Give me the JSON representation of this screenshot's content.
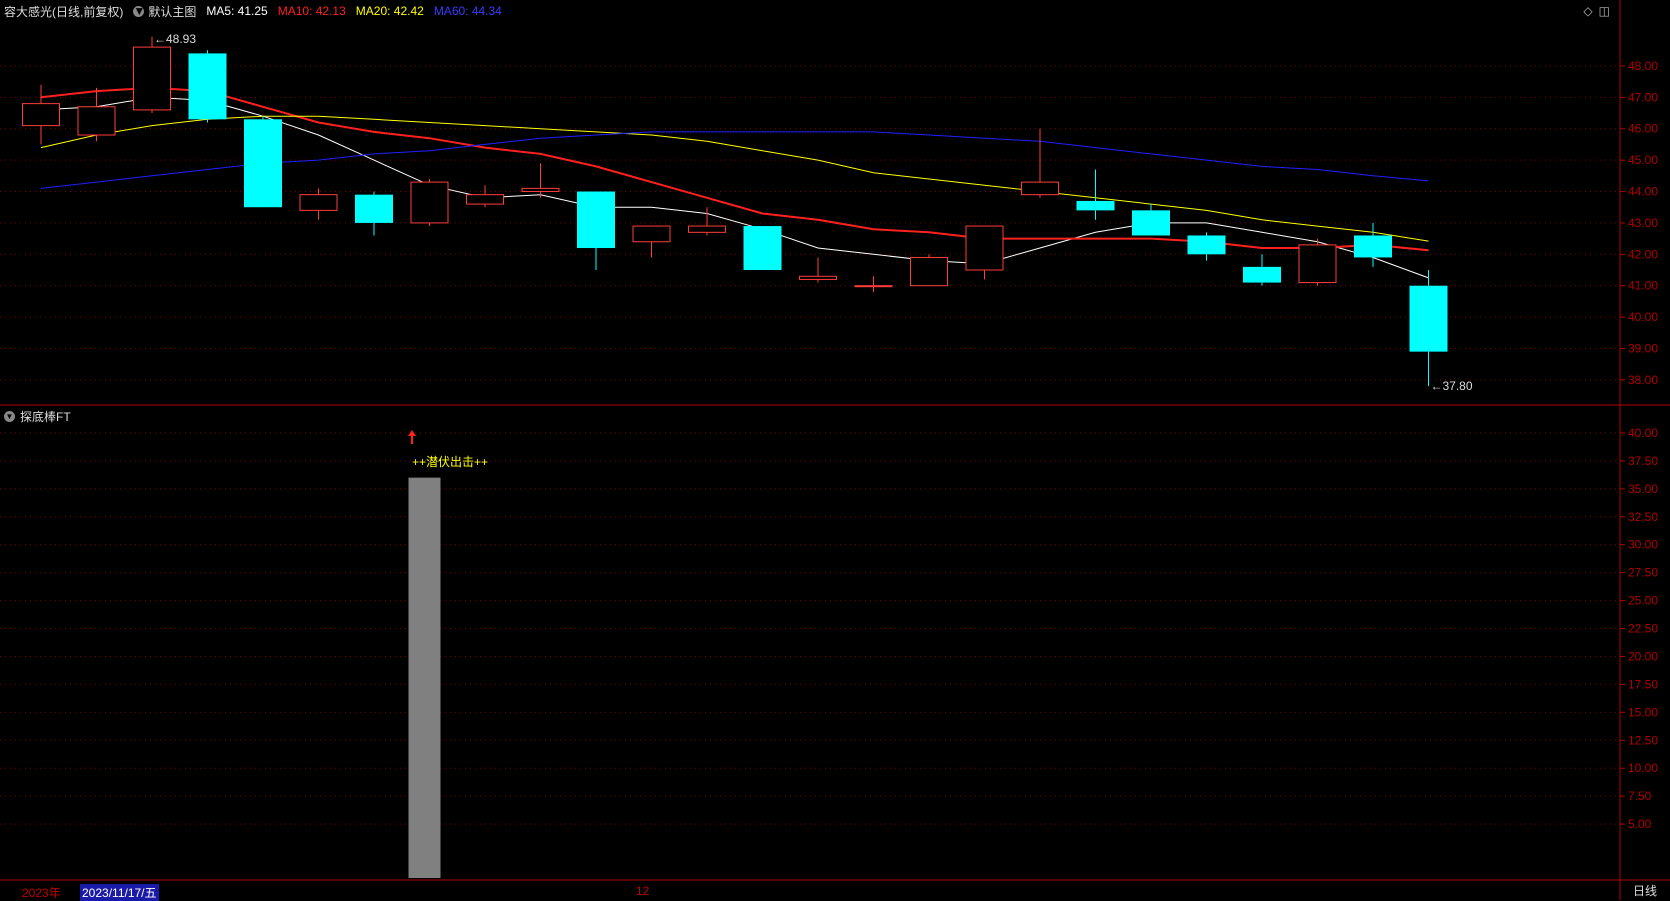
{
  "header": {
    "stock_title": "容大感光(日线,前复权)",
    "template_label": "默认主图",
    "ma5_label": "MA5: 41.25",
    "ma10_label": "MA10: 42.13",
    "ma20_label": "MA20: 42.42",
    "ma60_label": "MA60: 44.34"
  },
  "colors": {
    "up": "#ff3b3b",
    "down": "#00ffff",
    "ma5": "#ffffff",
    "ma10": "#ff2020",
    "ma20": "#ffff00",
    "ma60": "#2020ff",
    "axis": "#b00000",
    "bar": "#808080",
    "signal_text": "#ffff00"
  },
  "indicator": {
    "title": "探底棒FT",
    "signal_label": "++潜伏出击++"
  },
  "footer": {
    "year_label": "2023年",
    "date_label": "2023/11/17/五",
    "month_label": "12",
    "period_button": "日线"
  },
  "chart_data": [
    {
      "type": "candlestick",
      "ylim": [
        37.2,
        49.4
      ],
      "ytick_values": [
        38,
        39,
        40,
        41,
        42,
        43,
        44,
        45,
        46,
        47,
        48
      ],
      "ytick_labels": [
        "38.00",
        "39.00",
        "40.00",
        "41.00",
        "42.00",
        "43.00",
        "44.00",
        "45.00",
        "46.00",
        "47.00",
        "48.00"
      ],
      "candles": [
        {
          "o": 46.1,
          "h": 47.4,
          "l": 45.5,
          "c": 46.8
        },
        {
          "o": 45.8,
          "h": 47.3,
          "l": 45.6,
          "c": 46.7
        },
        {
          "o": 46.6,
          "h": 48.93,
          "l": 46.5,
          "c": 48.6
        },
        {
          "o": 48.4,
          "h": 48.5,
          "l": 46.2,
          "c": 46.3
        },
        {
          "o": 46.3,
          "h": 46.4,
          "l": 43.5,
          "c": 43.5
        },
        {
          "o": 43.4,
          "h": 44.1,
          "l": 43.1,
          "c": 43.9
        },
        {
          "o": 43.9,
          "h": 44.0,
          "l": 42.6,
          "c": 43.0
        },
        {
          "o": 43.0,
          "h": 44.4,
          "l": 42.9,
          "c": 44.3
        },
        {
          "o": 43.6,
          "h": 44.2,
          "l": 43.5,
          "c": 43.9
        },
        {
          "o": 44.0,
          "h": 44.9,
          "l": 43.8,
          "c": 44.1
        },
        {
          "o": 44.0,
          "h": 44.0,
          "l": 41.5,
          "c": 42.2
        },
        {
          "o": 42.4,
          "h": 42.9,
          "l": 41.9,
          "c": 42.9
        },
        {
          "o": 42.7,
          "h": 43.5,
          "l": 42.6,
          "c": 42.9
        },
        {
          "o": 42.9,
          "h": 42.9,
          "l": 41.5,
          "c": 41.5
        },
        {
          "o": 41.2,
          "h": 41.9,
          "l": 41.1,
          "c": 41.3
        },
        {
          "o": 41.0,
          "h": 41.3,
          "l": 40.8,
          "c": 41.0
        },
        {
          "o": 41.0,
          "h": 42.0,
          "l": 41.0,
          "c": 41.9
        },
        {
          "o": 41.5,
          "h": 42.9,
          "l": 41.2,
          "c": 42.9
        },
        {
          "o": 43.9,
          "h": 46.0,
          "l": 43.8,
          "c": 44.3
        },
        {
          "o": 43.7,
          "h": 44.7,
          "l": 43.1,
          "c": 43.4
        },
        {
          "o": 43.4,
          "h": 43.6,
          "l": 42.6,
          "c": 42.6
        },
        {
          "o": 42.6,
          "h": 42.7,
          "l": 41.8,
          "c": 42.0
        },
        {
          "o": 41.6,
          "h": 42.0,
          "l": 41.0,
          "c": 41.1
        },
        {
          "o": 41.1,
          "h": 42.5,
          "l": 41.0,
          "c": 42.3
        },
        {
          "o": 42.6,
          "h": 43.0,
          "l": 41.6,
          "c": 41.9
        },
        {
          "o": 41.0,
          "h": 41.5,
          "l": 37.8,
          "c": 38.9
        }
      ],
      "high_annotation": {
        "index": 2,
        "value": 48.93,
        "label": "48.93"
      },
      "low_annotation": {
        "index": 25,
        "value": 37.8,
        "label": "37.80"
      },
      "series": [
        {
          "name": "MA5",
          "values": [
            46.6,
            46.7,
            47.0,
            46.9,
            46.4,
            45.8,
            45.0,
            44.2,
            43.8,
            43.9,
            43.5,
            43.5,
            43.3,
            42.8,
            42.2,
            42.0,
            41.8,
            41.7,
            42.2,
            42.7,
            43.0,
            43.0,
            42.7,
            42.4,
            41.9,
            41.25
          ]
        },
        {
          "name": "MA10",
          "values": [
            47.0,
            47.2,
            47.3,
            47.2,
            46.7,
            46.2,
            45.9,
            45.7,
            45.4,
            45.2,
            44.8,
            44.3,
            43.8,
            43.3,
            43.1,
            42.8,
            42.7,
            42.5,
            42.5,
            42.5,
            42.5,
            42.4,
            42.2,
            42.2,
            42.3,
            42.13
          ]
        },
        {
          "name": "MA20",
          "values": [
            45.4,
            45.8,
            46.1,
            46.3,
            46.4,
            46.4,
            46.3,
            46.2,
            46.1,
            46.0,
            45.9,
            45.8,
            45.6,
            45.3,
            45.0,
            44.6,
            44.4,
            44.2,
            44.0,
            43.8,
            43.6,
            43.4,
            43.1,
            42.9,
            42.7,
            42.42
          ]
        },
        {
          "name": "MA60",
          "values": [
            44.1,
            44.3,
            44.5,
            44.7,
            44.9,
            45.0,
            45.2,
            45.3,
            45.5,
            45.7,
            45.8,
            45.9,
            45.9,
            45.9,
            45.9,
            45.9,
            45.8,
            45.7,
            45.6,
            45.4,
            45.2,
            45.0,
            44.8,
            44.7,
            44.5,
            44.34
          ]
        }
      ]
    },
    {
      "type": "bar",
      "ylim": [
        0,
        42.5
      ],
      "ytick_values": [
        5,
        7.5,
        10,
        12.5,
        15,
        17.5,
        20,
        22.5,
        25,
        27.5,
        30,
        32.5,
        35,
        37.5,
        40
      ],
      "ytick_labels": [
        "5.00",
        "7.50",
        "10.00",
        "12.50",
        "15.00",
        "17.50",
        "20.00",
        "22.50",
        "25.00",
        "27.50",
        "30.00",
        "32.50",
        "35.00",
        "37.50",
        "40.00"
      ],
      "bars": [
        {
          "index": 7,
          "value": 36.0
        }
      ]
    }
  ]
}
